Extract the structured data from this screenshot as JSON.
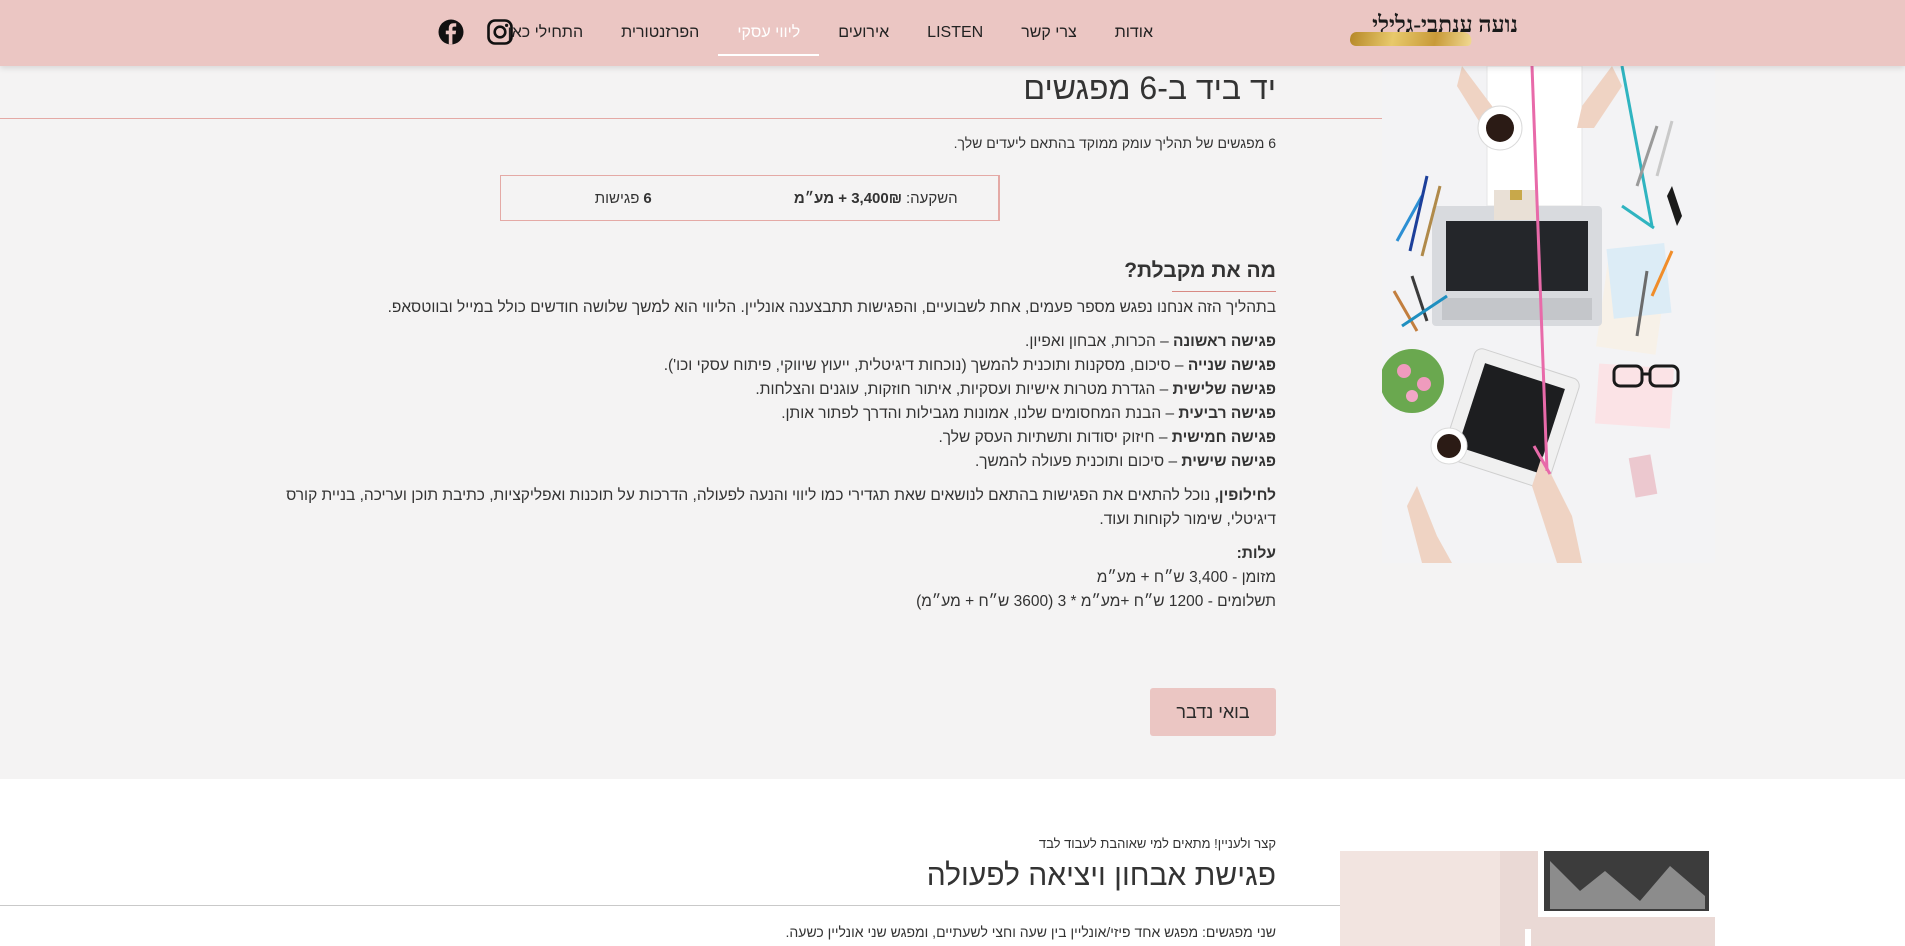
{
  "header": {
    "logo_text": "נועה ענתבי-גלילי",
    "nav": [
      {
        "label": "התחילי כאן",
        "active": false
      },
      {
        "label": "הפרזנטורית",
        "active": false
      },
      {
        "label": "ליווי עסקי",
        "active": true
      },
      {
        "label": "אירועים",
        "active": false
      },
      {
        "label": "LISTEN",
        "active": false
      },
      {
        "label": "צרי קשר",
        "active": false
      },
      {
        "label": "אודות",
        "active": false
      }
    ],
    "social": {
      "instagram_icon": "instagram-icon",
      "facebook_icon": "facebook-icon"
    },
    "colors": {
      "header_bg": "#ebc6c3",
      "accent": "#e4a9a5"
    }
  },
  "section1": {
    "title": "יד ביד ב-6 מפגשים",
    "subtitle": "6 מפגשים של תהליך עומק ממוקד בהתאם ליעדים שלך.",
    "table": {
      "meetings_count": "6",
      "meetings_label": "פגישות",
      "investment_label": "השקעה:",
      "investment_value": "3,400₪ + מע״מ"
    },
    "what_heading": "מה את מקבלת?",
    "intro": "בתהליך הזה אנחנו נפגש מספר פעמים, אחת לשבועיים, והפגישות תתבצענה אונליין. הליווי הוא למשך שלושה חודשים כולל במייל ובווטסאפ.",
    "meetings": [
      {
        "name": "פגישה ראשונה",
        "desc": " – הכרות, אבחון ואפיון."
      },
      {
        "name": "פגישה שנייה",
        "desc": " – סיכום, מסקנות ותוכנית להמשך (נוכחות דיגיטלית, ייעוץ שיווקי, פיתוח עסקי וכו').",
        "_": ""
      },
      {
        "name": "פגישה שלישית",
        "desc": " – הגדרת מטרות אישיות ועסקיות, איתור חוזקות, עוגנים והצלחות."
      },
      {
        "name": "פגישה רביעית",
        "desc": " – הבנת המחסומים שלנו, אמונות מגבילות והדרך לפתור אותן."
      },
      {
        "name": "פגישה חמישית",
        "desc": " – חיזוק יסודות ותשתיות העסק שלך."
      },
      {
        "name": "פגישה שישית",
        "desc": " – סיכום ותוכנית פעולה להמשך."
      }
    ],
    "alternative_label": "לחילופין,",
    "alternative_text": " נוכל להתאים את הפגישות בהתאם לנושאים שאת תגדירי כמו ליווי והנעה לפעולה, הדרכות על תוכנות ואפליקציות, כתיבת תוכן ועריכה, בניית קורס דיגיטלי, שימור לקוחות ועוד.",
    "costs_label": "עלות:",
    "cost_cash": "מזומן - 3,400 ש״ח + מע״מ",
    "cost_installments": "תשלומים - 1200 ש״ח +מע״מ * 3 (3600 ש״ח + מע״מ)",
    "cta_label": "בואי נדבר"
  },
  "section2": {
    "kicker": "קצר ולעניין! מתאים למי שאוהבת לעבוד לבד",
    "title": "פגישת אבחון ויציאה לפעולה",
    "subtitle": "שני מפגשים: מפגש אחד פיזי/אונליין בין שעה וחצי לשעתיים, ומפגש שני אונליין כשעה."
  }
}
